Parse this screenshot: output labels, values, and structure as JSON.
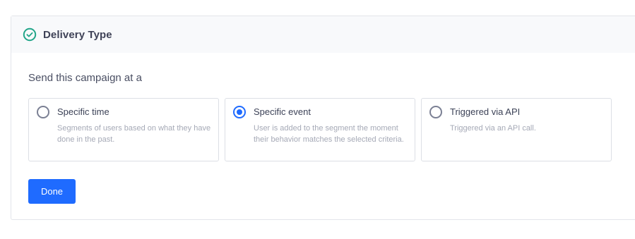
{
  "header": {
    "title": "Delivery Type",
    "icon": "check-circle-icon",
    "icon_color": "#22a589"
  },
  "prompt": "Send this campaign at a",
  "options": [
    {
      "title": "Specific time",
      "description": "Segments of users based on what they have done in the past.",
      "selected": false
    },
    {
      "title": "Specific event",
      "description": "User is added to the segment the moment their behavior matches the selected criteria.",
      "selected": true
    },
    {
      "title": "Triggered via API",
      "description": "Triggered via an API call.",
      "selected": false
    }
  ],
  "done_label": "Done",
  "colors": {
    "accent": "#1f6bff",
    "success": "#22a589"
  }
}
